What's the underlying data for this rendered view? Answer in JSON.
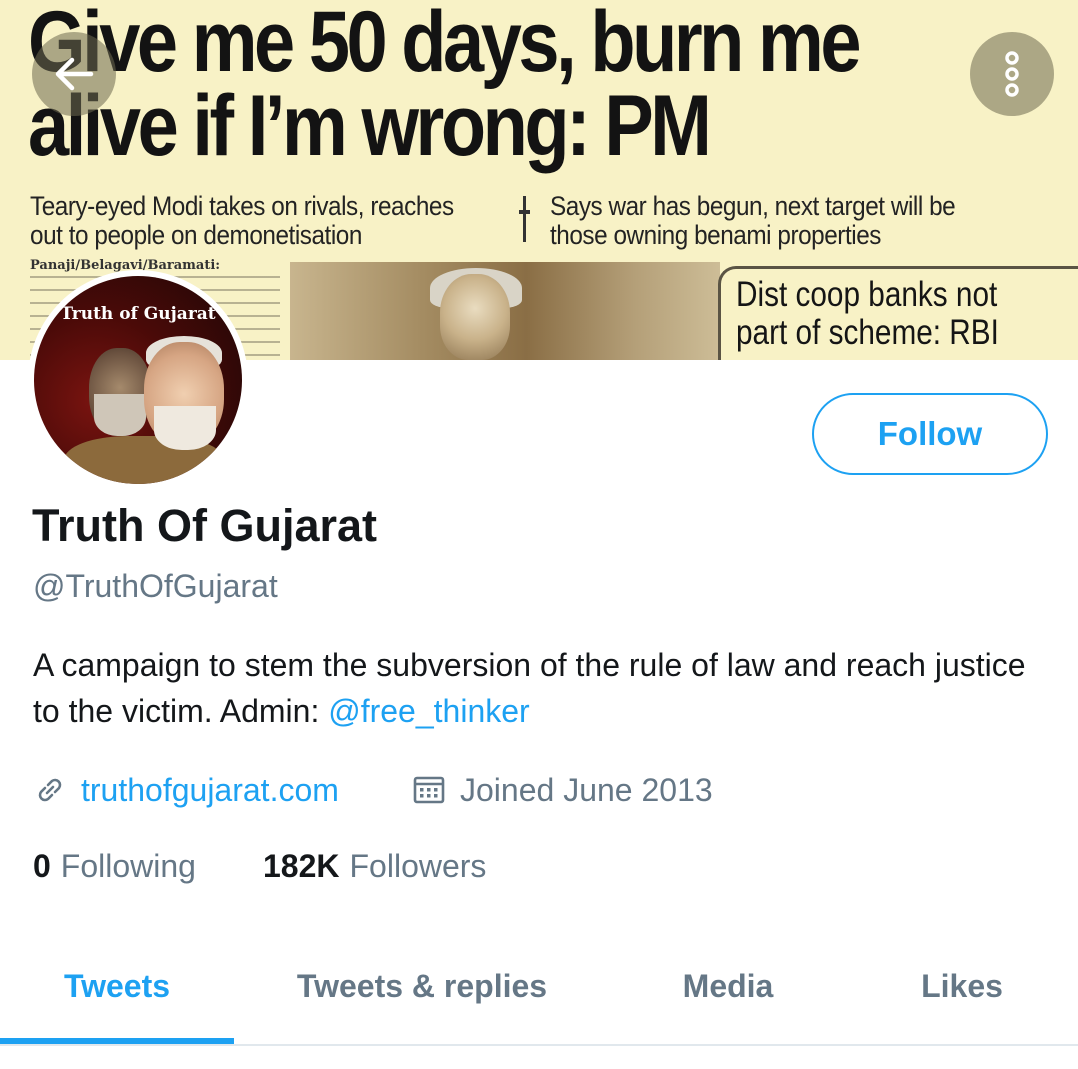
{
  "banner": {
    "headline_line1": "Give me 50 days, burn me",
    "headline_line2": "alive if I’m wrong: PM",
    "deck_left": "Teary-eyed Modi takes on rivals, reaches\nout to people on demonetisation",
    "deck_right": "Says war has begun, next target will be\nthose owning benami properties",
    "dateline": "Panaji/Belagavi/Baramati:",
    "sidebox": "Dist coop banks not\npart of scheme: RBI"
  },
  "avatar": {
    "text": "Truth of Gujarat"
  },
  "actions": {
    "follow_label": "Follow"
  },
  "profile": {
    "name": "Truth Of Gujarat",
    "handle": "@TruthOfGujarat",
    "bio_text": "A campaign to stem the subversion of the rule of law and reach justice to the victim. Admin: ",
    "bio_mention": "@free_thinker",
    "website": "truthofgujarat.com",
    "joined": "Joined June 2013"
  },
  "stats": {
    "following_count": "0",
    "following_label": "Following",
    "followers_count": "182K",
    "followers_label": "Followers"
  },
  "tabs": [
    {
      "label": "Tweets",
      "active": true
    },
    {
      "label": "Tweets & replies",
      "active": false
    },
    {
      "label": "Media",
      "active": false
    },
    {
      "label": "Likes",
      "active": false
    }
  ],
  "icons": {
    "back": "arrow-left-icon",
    "more": "more-vertical-icon",
    "link": "link-icon",
    "calendar": "calendar-icon"
  },
  "colors": {
    "accent": "#1da1f2",
    "secondary_text": "#657786",
    "primary_text": "#14171a",
    "banner_bg": "#f8f2c6"
  }
}
